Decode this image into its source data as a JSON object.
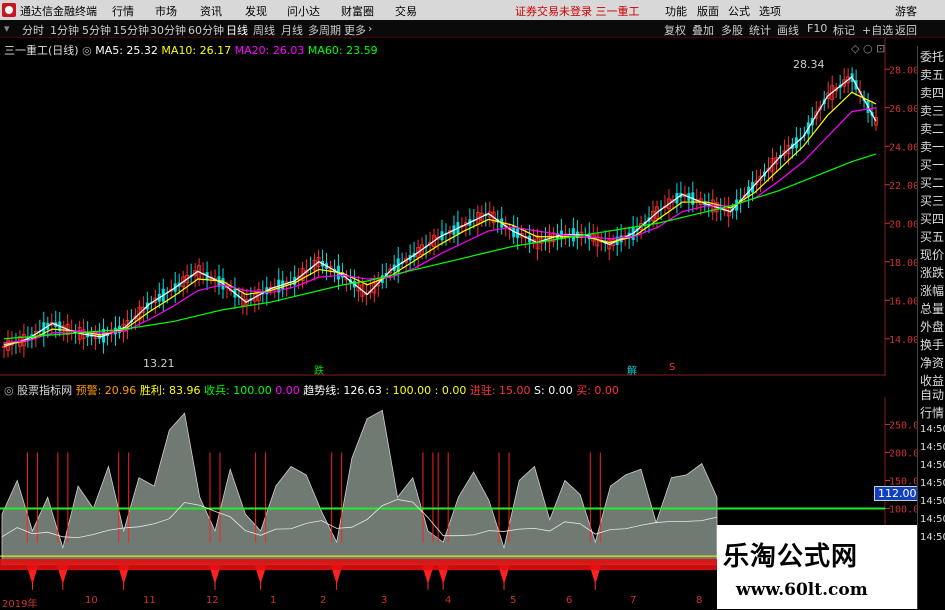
{
  "menubar": {
    "app_title": "通达信金融终端",
    "items": [
      "行情",
      "市场",
      "资讯",
      "发现",
      "问小达",
      "财富圈",
      "交易"
    ],
    "notice": "证券交易未登录  三一重工",
    "right_items": [
      "功能",
      "版面",
      "公式",
      "选项"
    ],
    "user": "游客"
  },
  "periodbar": {
    "periods": [
      "分时",
      "1分钟",
      "5分钟",
      "15分钟",
      "30分钟",
      "60分钟",
      "日线",
      "周线",
      "月线",
      "多周期",
      "更多"
    ],
    "active": "日线",
    "right_buttons": [
      "复权",
      "叠加",
      "多股",
      "统计",
      "画线",
      "F10",
      "标记",
      "+自选",
      "返回"
    ]
  },
  "price_chart": {
    "stock_label": "三一重工(日线)",
    "ma": [
      {
        "label": "MA5: 25.32",
        "color": "#ffffff"
      },
      {
        "label": "MA10: 26.17",
        "color": "#ffff00"
      },
      {
        "label": "MA20: 26.03",
        "color": "#ff00ff"
      },
      {
        "label": "MA60: 23.59",
        "color": "#00ff00"
      }
    ],
    "high_label": "28.34",
    "low_label": "13.21",
    "signals": [
      {
        "text": "跌",
        "color": "#00dd00"
      },
      {
        "text": "解",
        "color": "#00cccc"
      },
      {
        "text": "S",
        "color": "#ff3333"
      }
    ]
  },
  "chart_data": [
    {
      "type": "line",
      "title": "三一重工(日线)",
      "yticks": [
        "28.00",
        "26.00",
        "24.00",
        "22.00",
        "20.00",
        "18.00",
        "16.00",
        "14.00"
      ],
      "ylim": [
        13,
        29
      ],
      "series": [
        {
          "name": "MA5",
          "color": "#ffffff",
          "values": [
            13.6,
            14.0,
            14.8,
            14.3,
            14.1,
            14.6,
            15.8,
            16.6,
            17.5,
            16.9,
            15.9,
            16.6,
            17.0,
            18.0,
            17.3,
            16.3,
            17.6,
            18.4,
            19.3,
            19.9,
            20.5,
            19.6,
            19.0,
            19.4,
            19.4,
            18.9,
            19.5,
            20.6,
            21.5,
            21.0,
            20.6,
            22.0,
            23.4,
            24.5,
            26.6,
            27.6,
            25.3
          ]
        },
        {
          "name": "MA10",
          "color": "#ffff00",
          "values": [
            13.7,
            13.9,
            14.5,
            14.4,
            14.2,
            14.5,
            15.4,
            16.2,
            17.1,
            17.0,
            16.3,
            16.5,
            16.9,
            17.6,
            17.4,
            16.8,
            17.3,
            18.1,
            18.9,
            19.6,
            20.2,
            19.9,
            19.3,
            19.3,
            19.3,
            19.0,
            19.3,
            20.2,
            21.1,
            21.1,
            20.8,
            21.6,
            22.8,
            24.0,
            25.6,
            26.8,
            26.2
          ]
        },
        {
          "name": "MA20",
          "color": "#ff00ff",
          "values": [
            13.8,
            13.9,
            14.3,
            14.4,
            14.3,
            14.4,
            15.0,
            15.7,
            16.5,
            16.8,
            16.5,
            16.4,
            16.7,
            17.2,
            17.3,
            17.1,
            17.2,
            17.7,
            18.4,
            19.0,
            19.6,
            19.8,
            19.6,
            19.4,
            19.3,
            19.2,
            19.3,
            19.8,
            20.6,
            20.9,
            20.9,
            21.3,
            22.2,
            23.2,
            24.5,
            25.8,
            26.0
          ]
        },
        {
          "name": "MA60",
          "color": "#00ff00",
          "values": [
            14.0,
            14.1,
            14.2,
            14.3,
            14.4,
            14.5,
            14.7,
            14.9,
            15.2,
            15.5,
            15.7,
            15.9,
            16.2,
            16.5,
            16.8,
            17.0,
            17.3,
            17.6,
            17.9,
            18.2,
            18.5,
            18.8,
            19.0,
            19.2,
            19.4,
            19.6,
            19.8,
            20.0,
            20.3,
            20.6,
            20.9,
            21.3,
            21.7,
            22.2,
            22.7,
            23.2,
            23.6
          ]
        }
      ]
    },
    {
      "type": "area",
      "title": "股票指标网",
      "yticks": [
        "250.0",
        "200.0",
        "150.0",
        "100.0"
      ],
      "ylim": [
        -40,
        290
      ],
      "current_value_label": "112.00",
      "series": [
        {
          "name": "趋势线",
          "color": "#aaaaaa",
          "values": [
            90,
            150,
            60,
            120,
            30,
            140,
            100,
            175,
            60,
            155,
            140,
            240,
            270,
            120,
            60,
            170,
            90,
            60,
            140,
            175,
            160,
            95,
            40,
            190,
            260,
            275,
            120,
            155,
            60,
            40,
            120,
            165,
            115,
            30,
            150,
            175,
            80,
            150,
            125,
            40,
            140,
            160,
            170,
            75,
            155,
            160,
            180,
            120
          ]
        },
        {
          "name": "生命线",
          "color": "#00ff00",
          "values": [
            100,
            100,
            100,
            100,
            100,
            100,
            100,
            100,
            100,
            100,
            100,
            100,
            100,
            100,
            100,
            100,
            100,
            100,
            100,
            100,
            100,
            100,
            100,
            100,
            100,
            100,
            100,
            100,
            100,
            100,
            100,
            100,
            100,
            100,
            100,
            100,
            100,
            100,
            100,
            100,
            100,
            100,
            100,
            100,
            100,
            100,
            100,
            100
          ]
        }
      ]
    }
  ],
  "indicator": {
    "name": "股票指标网",
    "items": [
      {
        "label": "预警: 20.96",
        "color": "#ff9900"
      },
      {
        "label": "胜利: 83.96",
        "color": "#ffff00"
      },
      {
        "label": "收兵: 100.00",
        "color": "#00ff00"
      },
      {
        "label": "0.00",
        "color": "#ff00ff"
      },
      {
        "label": "趋势线: 126.63",
        "color": "#ffffff"
      },
      {
        "label": ": 100.00",
        "color": "#ffff00"
      },
      {
        "label": ": 0.00",
        "color": "#ffff00"
      },
      {
        "label": "进驻: 15.00",
        "color": "#ff3333"
      },
      {
        "label": "S: 0.00",
        "color": "#ffffff"
      },
      {
        "label": "买: 0.00",
        "color": "#ff3333"
      }
    ]
  },
  "side_panel": {
    "items": [
      "委托",
      "卖五",
      "卖四",
      "卖三",
      "卖二",
      "卖一",
      "买一",
      "买二",
      "买三",
      "买四",
      "买五",
      "现价",
      "涨跌",
      "涨幅",
      "总量",
      "外盘",
      "换手",
      "净资",
      "收益"
    ],
    "bottom_items": [
      "自动",
      "行情"
    ],
    "times": [
      "14:50",
      "14:50",
      "14:50",
      "14:50",
      "14:50",
      "14:50",
      "14:50"
    ]
  },
  "time_axis": {
    "labels": [
      "2019年",
      "10",
      "11",
      "12",
      "1",
      "2",
      "3",
      "4",
      "5",
      "6",
      "7",
      "8"
    ]
  },
  "watermark": {
    "title": "乐淘公式网",
    "url": "www.60lt.com"
  }
}
